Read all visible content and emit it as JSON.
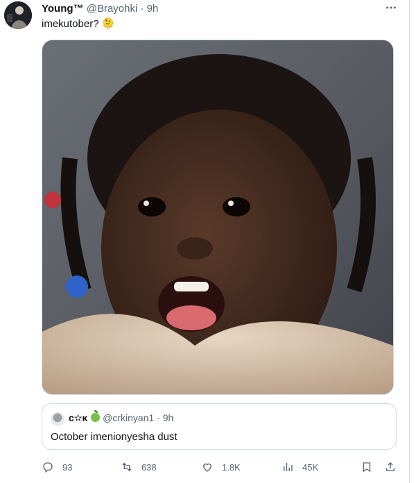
{
  "tweet": {
    "author_name": "Young™",
    "handle": "@Brayohki",
    "separator": "·",
    "time": "9h",
    "text": "imekutober? 🫠",
    "avatar_icon": "user-avatar",
    "more_icon": "more-horizontal-icon"
  },
  "media": {
    "description_icon": "photo"
  },
  "quote": {
    "author_name": "c✫κ",
    "handle": "@crkinyan1",
    "separator": "·",
    "time": "9h",
    "text": "October imenionyesha dust"
  },
  "actions": {
    "replies": "93",
    "reposts": "638",
    "likes": "1.8K",
    "views": "45K"
  },
  "colors": {
    "text": "#0f1419",
    "muted": "#536471",
    "border": "#cfd9de"
  }
}
